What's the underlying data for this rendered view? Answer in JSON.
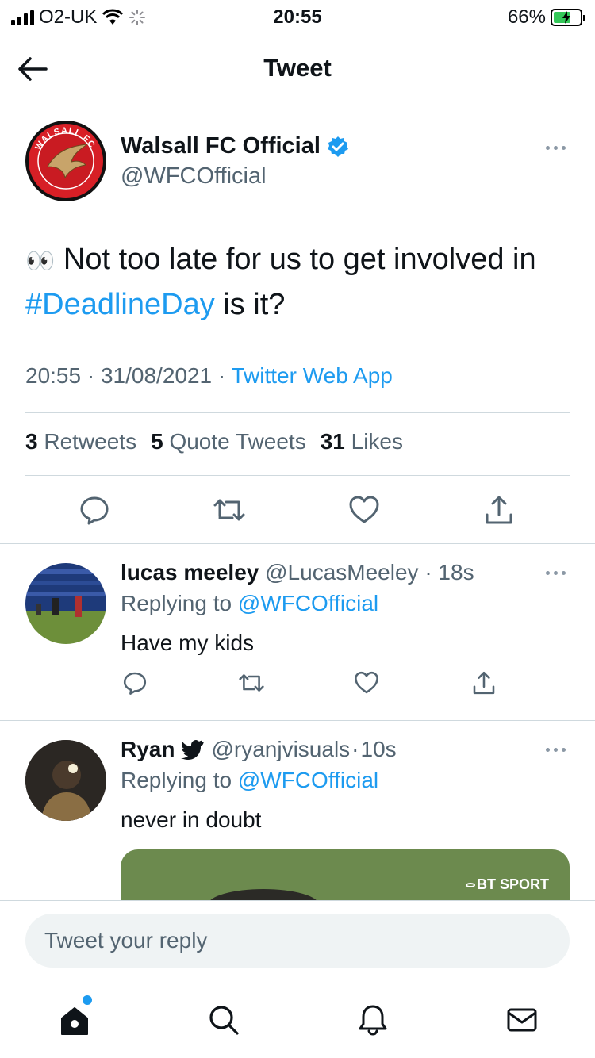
{
  "status_bar": {
    "carrier": "O2-UK",
    "time": "20:55",
    "battery_percent": "66%",
    "battery_level": 0.66
  },
  "nav": {
    "title": "Tweet"
  },
  "tweet": {
    "author_name": "Walsall FC Official",
    "author_handle": "@WFCOfficial",
    "avatar_text": "WALSALL FC",
    "emoji": "👀",
    "text_before": "Not too late for us to get involved in ",
    "hashtag": "#DeadlineDay",
    "text_after": " is it?",
    "time": "20:55",
    "date": "31/08/2021",
    "client": "Twitter Web App",
    "retweets_count": "3",
    "retweets_label": "Retweets",
    "quotes_count": "5",
    "quotes_label": "Quote Tweets",
    "likes_count": "31",
    "likes_label": "Likes"
  },
  "replies": [
    {
      "name": "lucas meeley",
      "handle": "@LucasMeeley",
      "age": "18s",
      "replying_label": "Replying to",
      "replying_to": "@WFCOfficial",
      "text": "Have my kids"
    },
    {
      "name": "Ryan",
      "handle": "@ryanjvisuals",
      "age": "10s",
      "replying_label": "Replying to",
      "replying_to": "@WFCOfficial",
      "text": "never in doubt",
      "media_watermark": "BT SPORT"
    }
  ],
  "composer": {
    "placeholder": "Tweet your reply"
  },
  "tab_bar": {
    "items": [
      "home-icon",
      "search-icon",
      "notifications-icon",
      "messages-icon"
    ]
  },
  "colors": {
    "accent": "#1d9bf0",
    "verified": "#1d9bf0",
    "battery": "#34c759",
    "walsall_red": "#d71f26"
  }
}
